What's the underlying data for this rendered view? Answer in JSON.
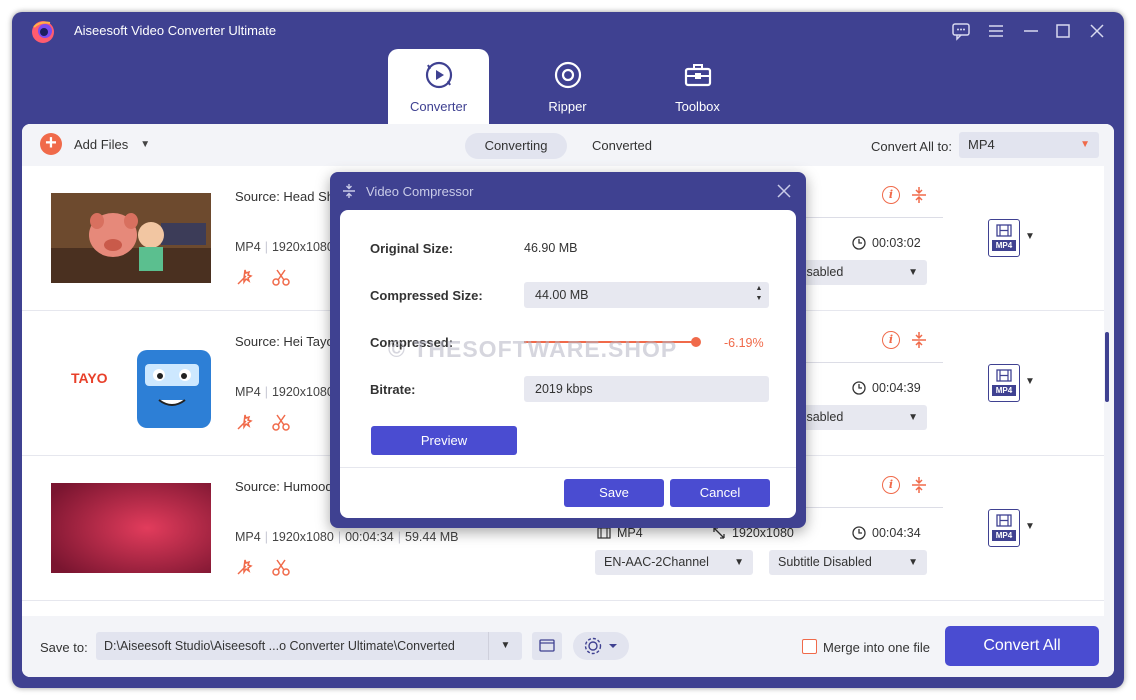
{
  "app": {
    "title": "Aiseesoft Video Converter Ultimate"
  },
  "window_controls": [
    {
      "name": "feedback-icon",
      "glyph": "💬"
    },
    {
      "name": "menu-icon",
      "glyph": "☰"
    },
    {
      "name": "minimize-icon",
      "glyph": "—"
    },
    {
      "name": "maximize-icon",
      "glyph": "☐"
    },
    {
      "name": "close-icon",
      "glyph": "✕"
    }
  ],
  "top_tabs": [
    {
      "label": "Converter",
      "icon": "converter-icon",
      "active": true
    },
    {
      "label": "Ripper",
      "icon": "ripper-icon",
      "active": false
    },
    {
      "label": "Toolbox",
      "icon": "toolbox-icon",
      "active": false
    }
  ],
  "toolbar": {
    "add_files": "Add Files",
    "seg_converting": "Converting",
    "seg_converted": "Converted",
    "convert_all_to": "Convert All to:",
    "format": "MP4"
  },
  "files": [
    {
      "source": "Source: Head Sh",
      "format": "MP4",
      "resolution": "1920x1080",
      "out_duration": "00:03:02",
      "subtitle": "tle Disabled"
    },
    {
      "source": "Source: Hei Tayo",
      "format": "MP4",
      "resolution": "1920x1080",
      "out_duration": "00:04:39",
      "subtitle": "tle Disabled"
    },
    {
      "source": "Source: Humood",
      "format": "MP4",
      "resolution": "1920x1080",
      "duration": "00:04:34",
      "size": "59.44 MB",
      "out_format": "MP4",
      "out_resolution": "1920x1080",
      "out_duration": "00:04:34",
      "audio": "EN-AAC-2Channel",
      "subtitle": "Subtitle Disabled"
    }
  ],
  "format_badge": "MP4",
  "bottom": {
    "save_to": "Save to:",
    "path": "D:\\Aiseesoft Studio\\Aiseesoft ...o Converter Ultimate\\Converted",
    "merge": "Merge into one file",
    "convert_all": "Convert All"
  },
  "dialog": {
    "title": "Video Compressor",
    "original_size_label": "Original Size:",
    "original_size": "46.90 MB",
    "compressed_size_label": "Compressed Size:",
    "compressed_size": "44.00 MB",
    "compressed_label": "Compressed:",
    "compressed_pct": "-6.19%",
    "compressed_ratio": 0.938,
    "bitrate_label": "Bitrate:",
    "bitrate": "2019 kbps",
    "preview": "Preview",
    "save": "Save",
    "cancel": "Cancel"
  },
  "watermark": "© THESOFTWARE.SHOP",
  "colors": {
    "brand": "#3f4191",
    "accent": "#f06a4a",
    "button": "#4a4cd1"
  }
}
